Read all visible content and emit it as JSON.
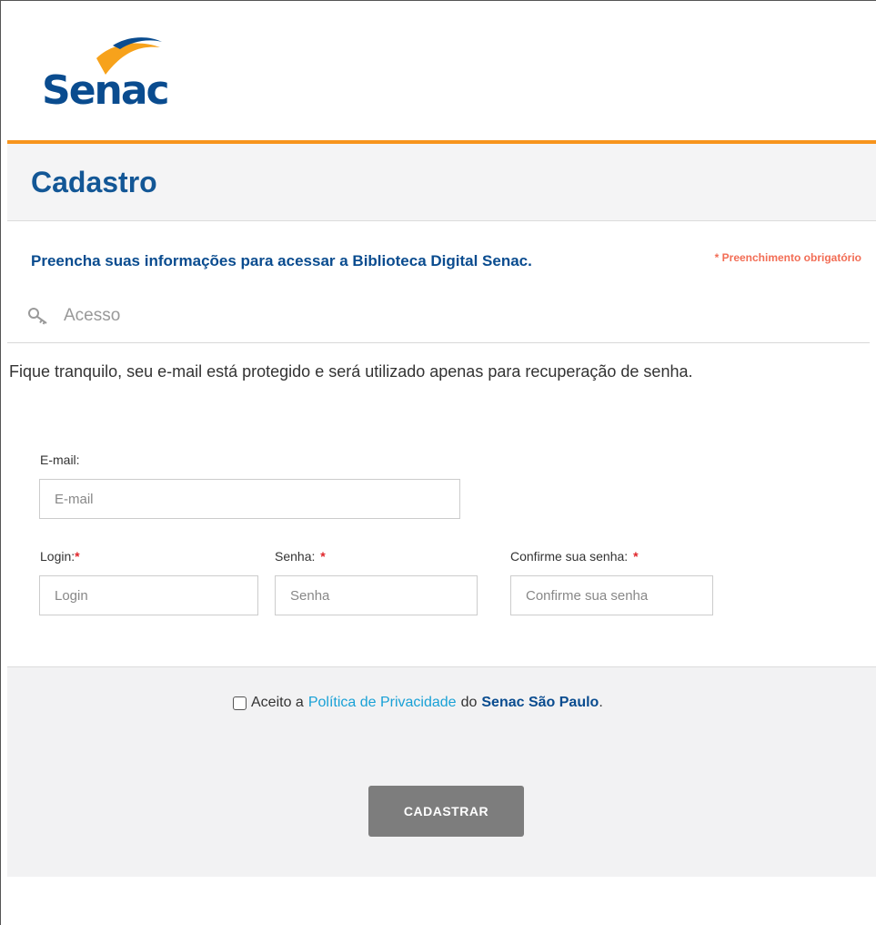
{
  "brand": {
    "logo_text": "Senac"
  },
  "page": {
    "title": "Cadastro",
    "intro": "Preencha suas informações para acessar a Biblioteca Digital Senac.",
    "required_note": "* Preenchimento obrigatório"
  },
  "section": {
    "icon": "key-icon",
    "label": "Acesso"
  },
  "privacy_notice": "Fique tranquilo, seu e-mail está protegido e será utilizado apenas para recuperação de senha.",
  "form": {
    "email": {
      "label": "E-mail:",
      "placeholder": "E-mail",
      "value": ""
    },
    "login": {
      "label": "Login:",
      "required_mark": "*",
      "placeholder": "Login",
      "value": ""
    },
    "password": {
      "label": "Senha:",
      "required_mark": "*",
      "placeholder": "Senha",
      "value": ""
    },
    "confirm": {
      "label": "Confirme sua senha:",
      "required_mark": "*",
      "placeholder": "Confirme sua senha",
      "value": ""
    }
  },
  "consent": {
    "prefix": "Aceito a",
    "policy_link": "Política de Privacidade",
    "middle": "do",
    "org": "Senac São Paulo",
    "suffix": ".",
    "checked": false
  },
  "submit_label": "CADASTRAR",
  "colors": {
    "brand_blue": "#0a4c8f",
    "title_blue": "#135796",
    "accent_orange": "#f7941d",
    "required_red": "#e0262b",
    "note_coral": "#f26d55",
    "link_cyan": "#19a1d6",
    "button_gray": "#7d7d7d"
  }
}
